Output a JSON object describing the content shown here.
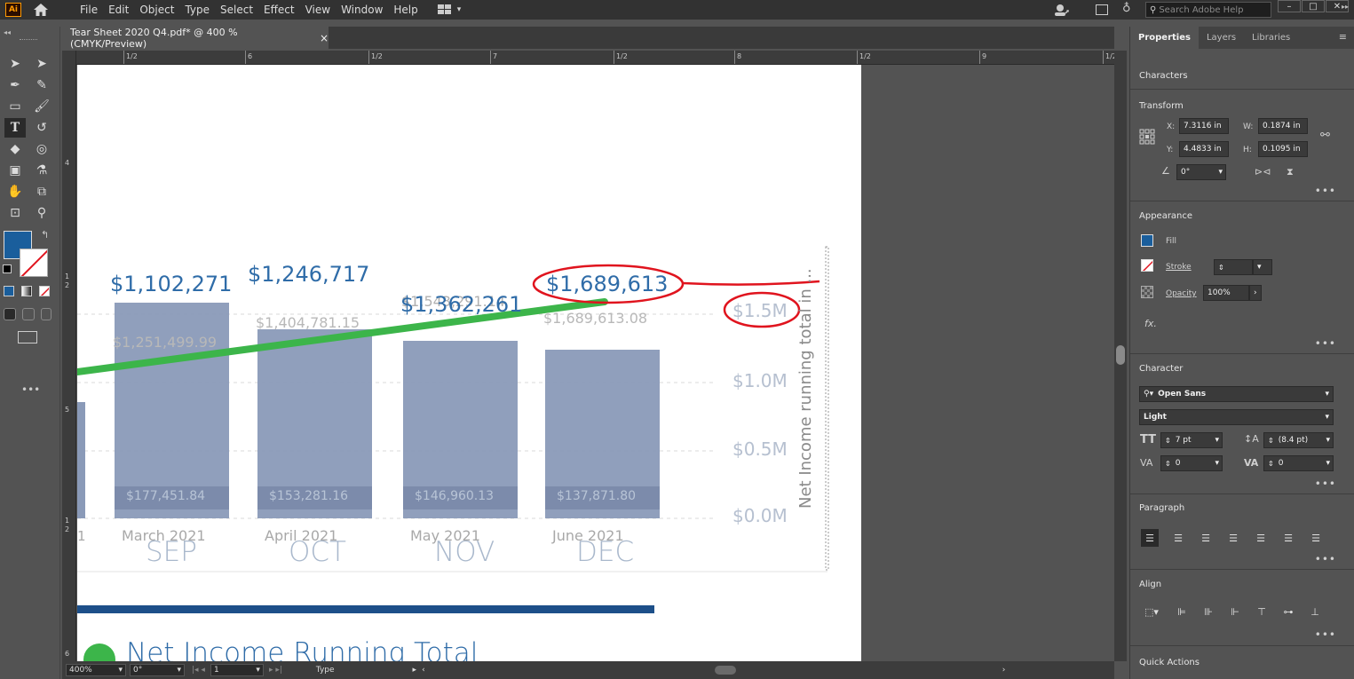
{
  "app": {
    "logo": "Ai",
    "menus": [
      "File",
      "Edit",
      "Object",
      "Type",
      "Select",
      "Effect",
      "View",
      "Window",
      "Help"
    ],
    "search_placeholder": "Search Adobe Help"
  },
  "document": {
    "tab_title": "Tear Sheet 2020 Q4.pdf* @ 400 % (CMYK/Preview)",
    "close": "×"
  },
  "ruler_top": [
    "1/2",
    "6",
    "1/2",
    "7",
    "1/2",
    "8",
    "1/2",
    "9",
    "1/2"
  ],
  "ruler_left": [
    "4",
    "1",
    "2",
    "5",
    "1",
    "2",
    "6"
  ],
  "status": {
    "zoom": "400%",
    "rotation": "0°",
    "artboard": "1",
    "tool": "Type"
  },
  "panel": {
    "tabs": [
      "Properties",
      "Layers",
      "Libraries"
    ],
    "characters_title": "Characters",
    "transform": {
      "title": "Transform",
      "x_label": "X:",
      "x": "7.3116 in",
      "y_label": "Y:",
      "y": "4.4833 in",
      "w_label": "W:",
      "w": "0.1874 in",
      "h_label": "H:",
      "h": "0.1095 in",
      "angle": "0°"
    },
    "appearance": {
      "title": "Appearance",
      "fill": "Fill",
      "stroke": "Stroke",
      "opacity": "Opacity",
      "opacity_value": "100%",
      "fx": "fx."
    },
    "character": {
      "title": "Character",
      "font": "Open Sans",
      "style": "Light",
      "size": "7 pt",
      "leading": "(8.4 pt)",
      "kerning": "0",
      "tracking": "0"
    },
    "paragraph_title": "Paragraph",
    "align_title": "Align",
    "quick_actions": "Quick Actions"
  },
  "colors": {
    "fill_swatch": "#1a5e9c",
    "accent_green": "#3cb54a",
    "annotation_red": "#e0141e",
    "bar": "#8a9ab8",
    "label_blue": "#2f6ca8"
  },
  "chart_data": {
    "type": "bar",
    "categories": [
      "March 2021",
      "April 2021",
      "May 2021",
      "June 2021"
    ],
    "month_labels": [
      "SEP",
      "OCT",
      "NOV",
      "DEC"
    ],
    "values": [
      1251499.99,
      1404781.15,
      1543291.14,
      1689613.08
    ],
    "value_labels": [
      "$1,251,499.99",
      "$1,404,781.15",
      "$1,543,291.14",
      "$1,689,613.08"
    ],
    "bottom_labels": [
      "$177,451.84",
      "$153,281.16",
      "$146,960.13",
      "$137,871.80"
    ],
    "top_labels": [
      "$1,102,271",
      "$1,246,717",
      "$1,362,261",
      "$1,689,613"
    ],
    "yticks": [
      "$1.5M",
      "$1.0M",
      "$0.5M",
      "$0.0M"
    ],
    "ylabel": "Net Income running total in ...",
    "ylim": [
      0,
      1500000
    ],
    "prev_category_fragment": "1",
    "section_heading": "Net Income Running Total"
  }
}
